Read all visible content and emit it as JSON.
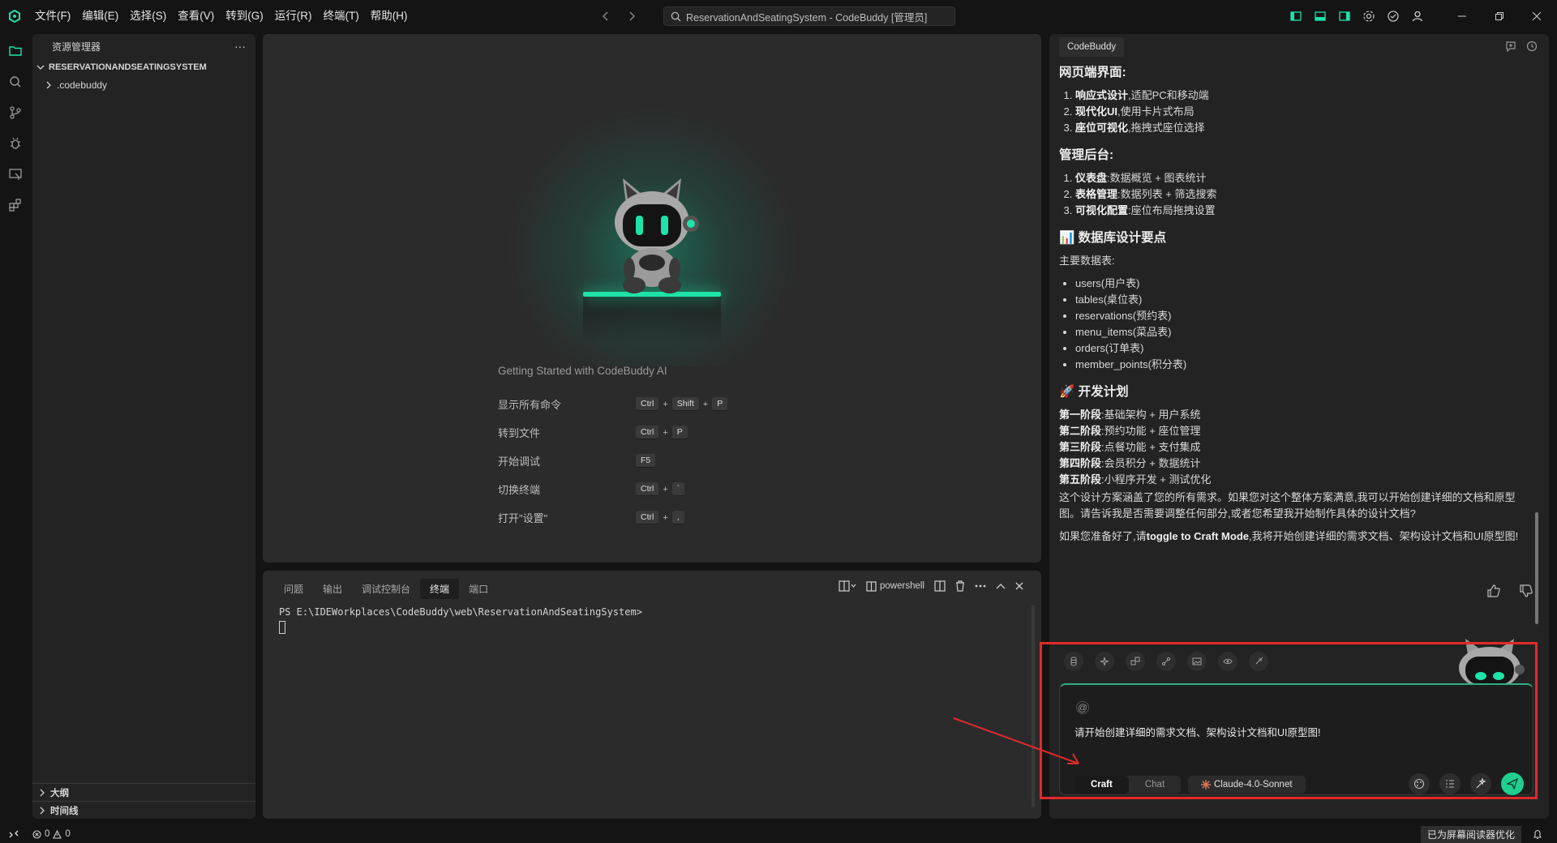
{
  "titlebar": {
    "menu": [
      "文件(F)",
      "编辑(E)",
      "选择(S)",
      "查看(V)",
      "转到(G)",
      "运行(R)",
      "终端(T)",
      "帮助(H)"
    ],
    "search_text": "ReservationAndSeatingSystem - CodeBuddy [管理员]",
    "accent": "#1de3a8"
  },
  "sidebar": {
    "title": "资源管理器",
    "more": "···",
    "root": "RESERVATIONANDSEATINGSYSTEM",
    "folder": ".codebuddy",
    "outline": "大纲",
    "timeline": "时间线"
  },
  "editor": {
    "welcome_title": "Getting Started with CodeBuddy AI",
    "shortcuts": [
      {
        "label": "显示所有命令",
        "keys": [
          "Ctrl",
          "+",
          "Shift",
          "+",
          "P"
        ]
      },
      {
        "label": "转到文件",
        "keys": [
          "Ctrl",
          "+",
          "P"
        ]
      },
      {
        "label": "开始调试",
        "keys": [
          "F5"
        ]
      },
      {
        "label": "切换终端",
        "keys": [
          "Ctrl",
          "+",
          "`"
        ]
      },
      {
        "label": "打开\"设置\"",
        "keys": [
          "Ctrl",
          "+",
          ","
        ]
      }
    ]
  },
  "panel": {
    "tabs": [
      "问题",
      "输出",
      "调试控制台",
      "终端",
      "端口"
    ],
    "active_tab": 3,
    "shell": "powershell",
    "prompt": "PS E:\\IDEWorkplaces\\CodeBuddy\\web\\ReservationAndSeatingSystem>"
  },
  "chat": {
    "tab": "CodeBuddy",
    "web_heading": "网页端界面:",
    "web_items": [
      {
        "b": "响应式设计",
        "t": ",适配PC和移动端"
      },
      {
        "b": "现代化UI",
        "t": ",使用卡片式布局"
      },
      {
        "b": "座位可视化",
        "t": ",拖拽式座位选择"
      }
    ],
    "admin_heading": "管理后台:",
    "admin_items": [
      {
        "b": "仪表盘",
        "t": ":数据概览 + 图表统计"
      },
      {
        "b": "表格管理",
        "t": ":数据列表 + 筛选搜索"
      },
      {
        "b": "可视化配置",
        "t": ":座位布局拖拽设置"
      }
    ],
    "db_heading": "📊 数据库设计要点",
    "db_intro": "主要数据表:",
    "db_tables": [
      "users(用户表)",
      "tables(桌位表)",
      "reservations(预约表)",
      "menu_items(菜品表)",
      "orders(订单表)",
      "member_points(积分表)"
    ],
    "plan_heading": "🚀 开发计划",
    "phases": [
      {
        "b": "第一阶段",
        "t": ":基础架构 + 用户系统"
      },
      {
        "b": "第二阶段",
        "t": ":预约功能 + 座位管理"
      },
      {
        "b": "第三阶段",
        "t": ":点餐功能 + 支付集成"
      },
      {
        "b": "第四阶段",
        "t": ":会员积分 + 数据统计"
      },
      {
        "b": "第五阶段",
        "t": ":小程序开发 + 测试优化"
      }
    ],
    "summary": "这个设计方案涵盖了您的所有需求。如果您对这个整体方案满意,我可以开始创建详细的文档和原型图。请告诉我是否需要调整任何部分,或者您希望我开始制作具体的设计文档?",
    "ready_prefix": "如果您准备好了,请",
    "ready_bold": "toggle to Craft Mode",
    "ready_suffix": ",我将开始创建详细的需求文档、架构设计文档和UI原型图!"
  },
  "composer": {
    "at": "@",
    "text": "请开始创建详细的需求文档、架构设计文档和UI原型图!",
    "mode_craft": "Craft",
    "mode_chat": "Chat",
    "model": "Claude-4.0-Sonnet"
  },
  "statusbar": {
    "errors": "0",
    "warnings": "0",
    "a11y": "已为屏幕阅读器优化"
  }
}
